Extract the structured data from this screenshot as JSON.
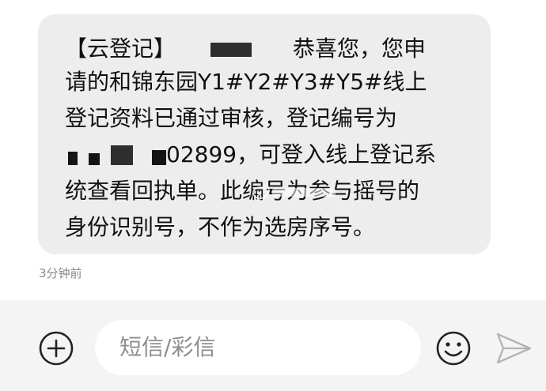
{
  "message": {
    "lines": [
      "【云登记】",
      "恭喜您，您申",
      "请的和锦东园Y1#Y2#Y3#Y5#线上",
      "登记资料已通过审核，登记编号为",
      "02899，可登入线上登记系",
      "统查看回执单。此编号为参与摇号的",
      "身份识别号，不作为选房序号。"
    ],
    "timestamp": "3分钟前"
  },
  "compose": {
    "placeholder": "短信/彩信"
  },
  "colors": {
    "bubble": "#ededed",
    "text": "#111111",
    "timestamp": "#8a8a8a",
    "compose_bar": "#f4f4f4",
    "icon": "#222222"
  },
  "icons": {
    "attach": "plus-circle-icon",
    "emoji": "smiley-icon",
    "send": "send-arrow-icon"
  }
}
